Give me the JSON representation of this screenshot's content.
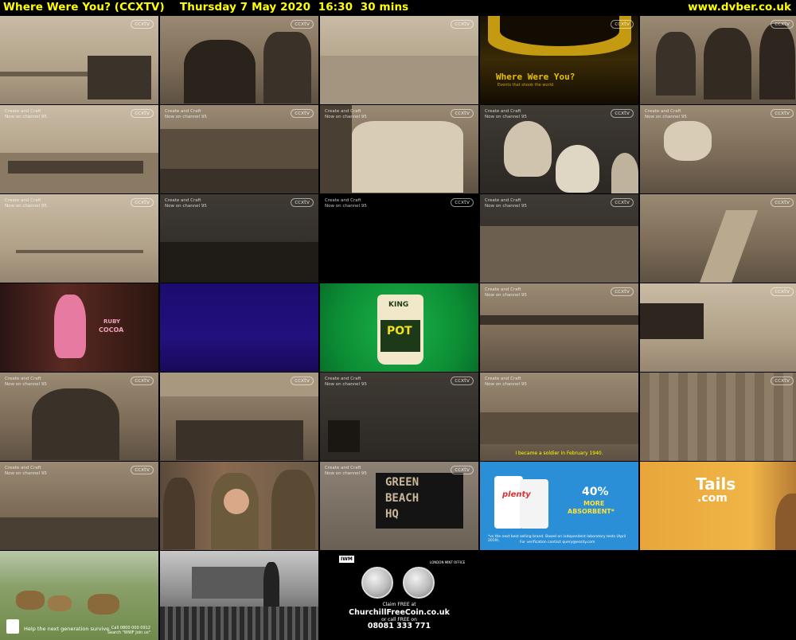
{
  "header": {
    "title": "Where Were You? (CCXTV)    Thursday 7 May 2020  16:30  30 mins",
    "site": "www.dvber.co.uk"
  },
  "channel": {
    "watermark": "ccxtv",
    "promo_line1": "Create and Craft",
    "promo_line2": "Now on channel 95"
  },
  "thumbnails": {
    "yellow_title": "Where Were You?",
    "yellow_subtitle": "Events that shook the world",
    "caption_row5": "I became a soldier in February 1940.",
    "cocoa_brand": "RUBY",
    "cocoa_word": "COCOA",
    "potnoodle_top": "KING",
    "potnoodle_word": "POT",
    "plenty_brand": "plenty",
    "plenty_pct": "40%",
    "plenty_more": "MORE",
    "plenty_absorbent": "ABSORBENT*",
    "plenty_note1": "*vs the next best selling brand. Based on independent laboratory tests (April 2019).",
    "plenty_note2": "For verification contact query@essity.com",
    "tails_brand": "Tails",
    "tails_com": ".com",
    "sign_line1": "GREEN",
    "sign_line2": "BEACH",
    "sign_line3": "HQ",
    "wwf_tag": "Help the next generation survive.",
    "wwf_call": "Call 0800 000 0912",
    "wwf_search": "Search \"WWF Join us\"",
    "coin_iwm": "IWM",
    "coin_mint": "LONDON MINT OFFICE",
    "coin_claim": "Claim FREE at",
    "coin_url": "ChurchillFreeCoin.co.uk",
    "coin_call": "or call FREE on",
    "coin_phone": "08081 333 771"
  }
}
